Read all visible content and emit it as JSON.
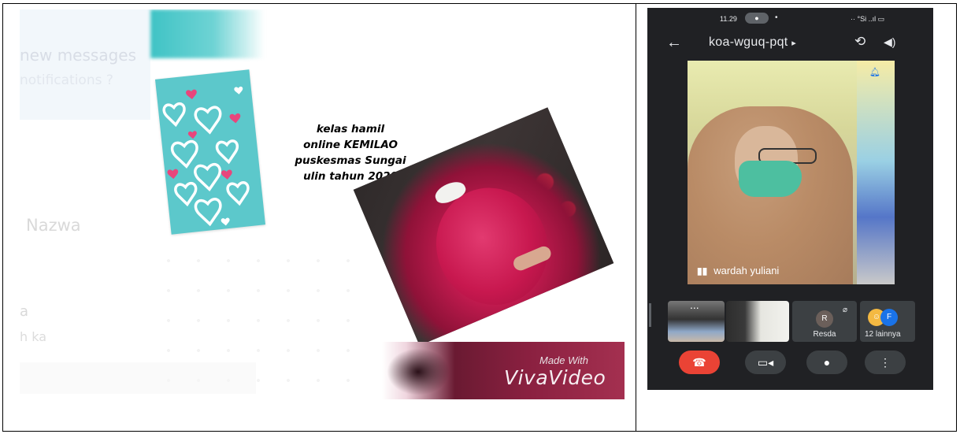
{
  "left_video": {
    "ghost_text": {
      "line1": "new messages",
      "line2": "notifications ?",
      "name": "Nazwa",
      "line4": "a",
      "line5": "h ka"
    },
    "caption": {
      "line1": "kelas hamil",
      "line2": "online KEMILAO",
      "line3": "puskesmas Sungai",
      "line4": "ulin tahun 2020"
    },
    "watermark": {
      "made_with": "Made With",
      "brand": "VivaVideo"
    },
    "colors": {
      "card_teal": "#5cc8cb",
      "heart_pink": "#e8467c",
      "dress_magenta": "#c8184f"
    }
  },
  "meet": {
    "status_bar": {
      "time": "11.29",
      "mic_indicator": "mic-icon",
      "dot": "•",
      "right_icons": "·· °Si ..ıl ▭"
    },
    "header": {
      "back_icon": "arrow-back-icon",
      "meeting_code": "koa-wguq-pqt",
      "chevron": "▸",
      "flip_icon": "camera-flip-icon",
      "audio_icon": "speaker-icon"
    },
    "main_tile": {
      "participant_name": "wardah yuliani",
      "audio_bars_icon": "audio-level-icon",
      "pin_icon": "pin-icon"
    },
    "thumbnails": [
      {
        "type": "video",
        "more": "..."
      },
      {
        "type": "video"
      },
      {
        "type": "avatar",
        "initial": "R",
        "name": "Resda",
        "muted_icon": "mic-off-icon"
      },
      {
        "type": "group",
        "initial_2": "F",
        "label": "12 lainnya"
      }
    ],
    "controls": {
      "end_call_icon": "call-end-icon",
      "camera_icon": "videocam-icon",
      "mic_icon": "mic-icon",
      "more_icon": "more-vert-icon"
    },
    "colors": {
      "background": "#202124",
      "end_call": "#ea4335",
      "control_bg": "#3c4043",
      "pin_blue": "#1a73e8"
    }
  }
}
